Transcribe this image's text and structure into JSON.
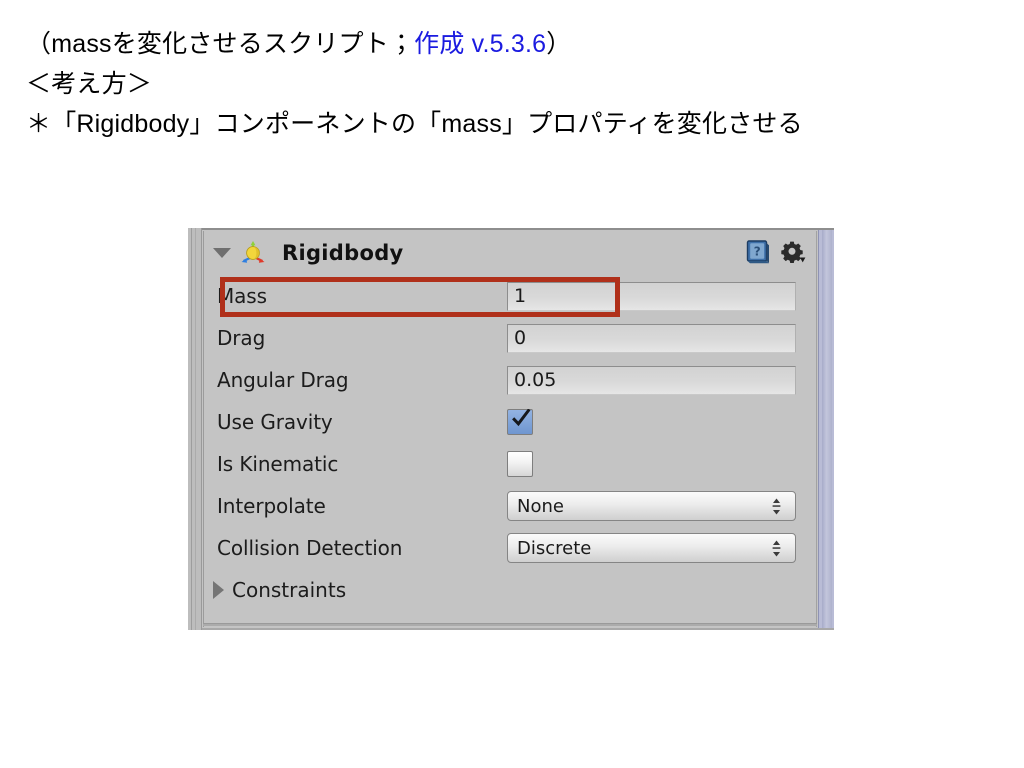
{
  "slide": {
    "line1_pre": "（massを変化させるスクリプト；",
    "line1_accent": "作成 v.5.3.6",
    "line1_post": "）",
    "line2": "＜考え方＞",
    "line3": "＊「Rigidbody」コンポーネントの「mass」プロパティを変化させる",
    "accent_color": "#1b1be0"
  },
  "inspector": {
    "component_title": "Rigidbody",
    "component_icon": "rigidbody-icon",
    "foldout_icon": "chevron-down-icon",
    "help_icon": "help-book-icon",
    "gear_icon": "gear-icon",
    "panel_bg": "#c4c4c4",
    "highlight_color": "#b0301a",
    "rows": [
      {
        "label": "Mass",
        "type": "field",
        "value": "1"
      },
      {
        "label": "Drag",
        "type": "field",
        "value": "0"
      },
      {
        "label": "Angular Drag",
        "type": "field",
        "value": "0.05"
      },
      {
        "label": "Use Gravity",
        "type": "checkbox",
        "value": "checked"
      },
      {
        "label": "Is Kinematic",
        "type": "checkbox",
        "value": "unchecked"
      },
      {
        "label": "Interpolate",
        "type": "dropdown",
        "value": "None"
      },
      {
        "label": "Collision Detection",
        "type": "dropdown",
        "value": "Discrete"
      }
    ],
    "constraints": {
      "label": "Constraints",
      "foldout_icon": "chevron-right-icon",
      "expanded": false
    }
  }
}
